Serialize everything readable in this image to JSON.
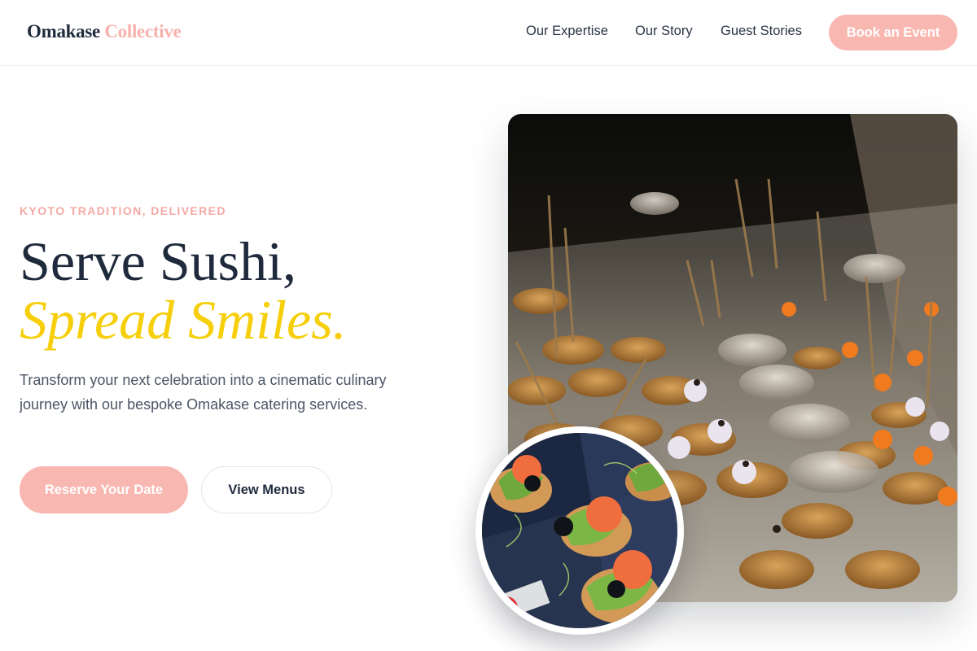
{
  "header": {
    "logo_primary": "Omakase",
    "logo_accent": "Collective",
    "nav": [
      "Our Expertise",
      "Our Story",
      "Guest Stories"
    ],
    "cta": "Book an Event"
  },
  "hero": {
    "eyebrow": "KYOTO TRADITION, DELIVERED",
    "headline_line1": "Serve Sushi,",
    "headline_line2": "Spread Smiles.",
    "lead": "Transform your next celebration into a cinematic culinary journey with our bespoke Omakase catering services.",
    "primary_button": "Reserve Your Date",
    "secondary_button": "View Menus"
  },
  "colors": {
    "accent_pink": "#f9b7b1",
    "accent_yellow": "#f6cf0a",
    "navy": "#1f2a3c"
  }
}
